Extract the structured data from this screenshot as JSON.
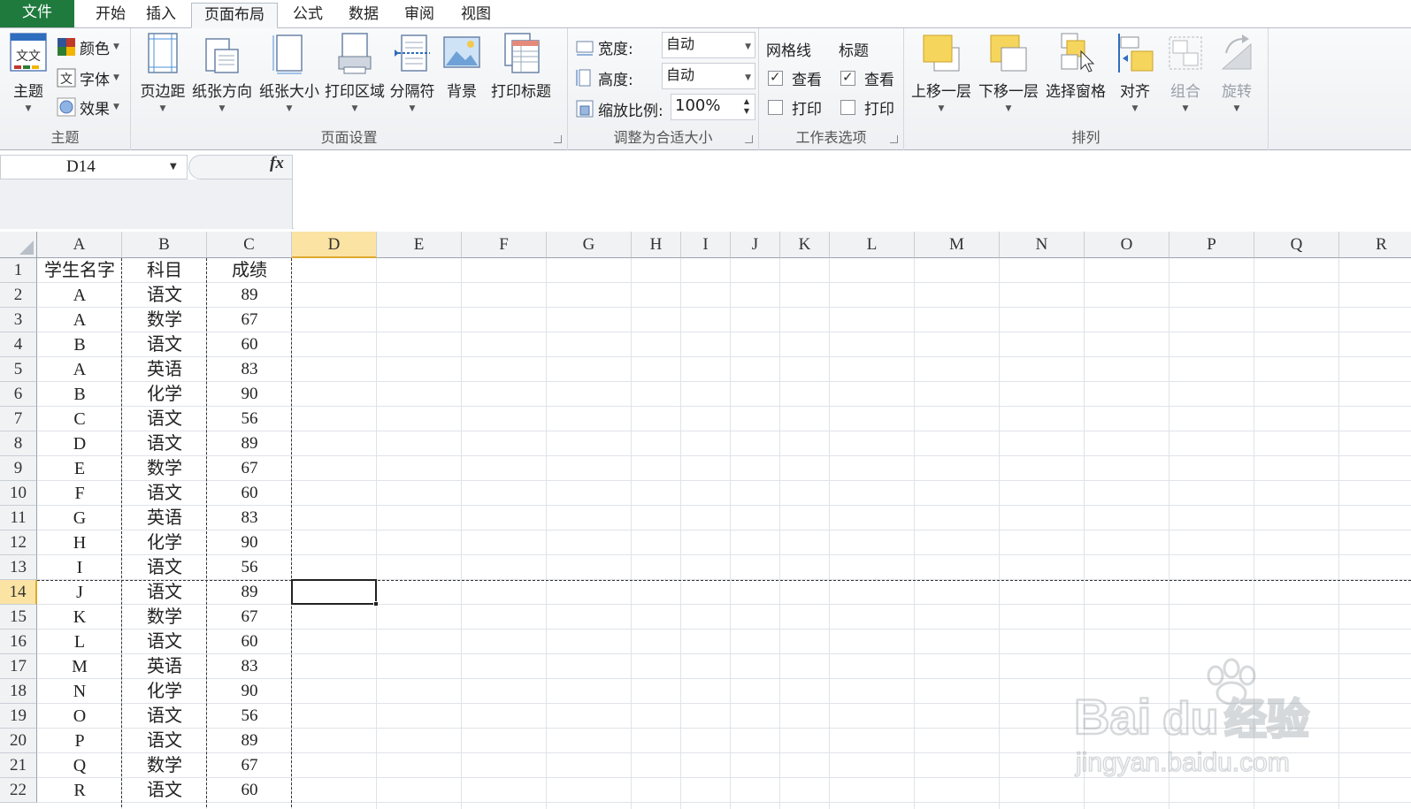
{
  "tabs": {
    "file": "文件",
    "items": [
      "开始",
      "插入",
      "页面布局",
      "公式",
      "数据",
      "审阅",
      "视图"
    ],
    "active_index": 2
  },
  "ribbon": {
    "theme_group": {
      "label": "主题",
      "themes_button": "主题",
      "colors": "颜色",
      "fonts": "字体",
      "effects": "效果",
      "themes_icon_text": "文文"
    },
    "page_setup_group": {
      "label": "页面设置",
      "buttons": [
        "页边距",
        "纸张方向",
        "纸张大小",
        "打印区域",
        "分隔符",
        "背景",
        "打印标题"
      ]
    },
    "scale_group": {
      "label": "调整为合适大小",
      "width_label": "宽度:",
      "width_value": "自动",
      "height_label": "高度:",
      "height_value": "自动",
      "scale_label": "缩放比例:",
      "scale_value": "100%"
    },
    "sheet_options_group": {
      "label": "工作表选项",
      "gridlines_header": "网格线",
      "headings_header": "标题",
      "view_label": "查看",
      "print_label": "打印",
      "gridlines_view_checked": true,
      "gridlines_print_checked": false,
      "headings_view_checked": true,
      "headings_print_checked": false
    },
    "arrange_group": {
      "label": "排列",
      "buttons": [
        "上移一层",
        "下移一层",
        "选择窗格",
        "对齐",
        "组合",
        "旋转"
      ],
      "disabled": [
        "组合",
        "旋转"
      ]
    }
  },
  "formula_bar": {
    "name_box": "D14",
    "fx": "fx",
    "formula": ""
  },
  "sheet": {
    "columns": [
      "A",
      "B",
      "C",
      "D",
      "E",
      "F",
      "G",
      "H",
      "I",
      "J",
      "K",
      "L",
      "M",
      "N",
      "O",
      "P",
      "Q",
      "R"
    ],
    "selected_column": "D",
    "selected_row": 14,
    "rows": [
      {
        "n": "1",
        "a": "学生名字",
        "b": "科目",
        "c": "成绩"
      },
      {
        "n": "2",
        "a": "A",
        "b": "语文",
        "c": "89"
      },
      {
        "n": "3",
        "a": "A",
        "b": "数学",
        "c": "67"
      },
      {
        "n": "4",
        "a": "B",
        "b": "语文",
        "c": "60"
      },
      {
        "n": "5",
        "a": "A",
        "b": "英语",
        "c": "83"
      },
      {
        "n": "6",
        "a": "B",
        "b": "化学",
        "c": "90"
      },
      {
        "n": "7",
        "a": "C",
        "b": "语文",
        "c": "56"
      },
      {
        "n": "8",
        "a": "D",
        "b": "语文",
        "c": "89"
      },
      {
        "n": "9",
        "a": "E",
        "b": "数学",
        "c": "67"
      },
      {
        "n": "10",
        "a": "F",
        "b": "语文",
        "c": "60"
      },
      {
        "n": "11",
        "a": "G",
        "b": "英语",
        "c": "83"
      },
      {
        "n": "12",
        "a": "H",
        "b": "化学",
        "c": "90"
      },
      {
        "n": "13",
        "a": "I",
        "b": "语文",
        "c": "56"
      },
      {
        "n": "14",
        "a": "J",
        "b": "语文",
        "c": "89"
      },
      {
        "n": "15",
        "a": "K",
        "b": "数学",
        "c": "67"
      },
      {
        "n": "16",
        "a": "L",
        "b": "语文",
        "c": "60"
      },
      {
        "n": "17",
        "a": "M",
        "b": "英语",
        "c": "83"
      },
      {
        "n": "18",
        "a": "N",
        "b": "化学",
        "c": "90"
      },
      {
        "n": "19",
        "a": "O",
        "b": "语文",
        "c": "56"
      },
      {
        "n": "20",
        "a": "P",
        "b": "语文",
        "c": "89"
      },
      {
        "n": "21",
        "a": "Q",
        "b": "数学",
        "c": "67"
      },
      {
        "n": "22",
        "a": "R",
        "b": "语文",
        "c": "60"
      }
    ]
  },
  "watermark": {
    "brand": "Bai",
    "brand_suffix": "du",
    "brand_cn": "经验",
    "url": "jingyan.baidu.com"
  },
  "colors": {
    "file_tab": "#1f7a3d",
    "selected_header": "#fbe3a3",
    "selected_header_border": "#e0a82e",
    "gridline": "#dfe3e8"
  }
}
